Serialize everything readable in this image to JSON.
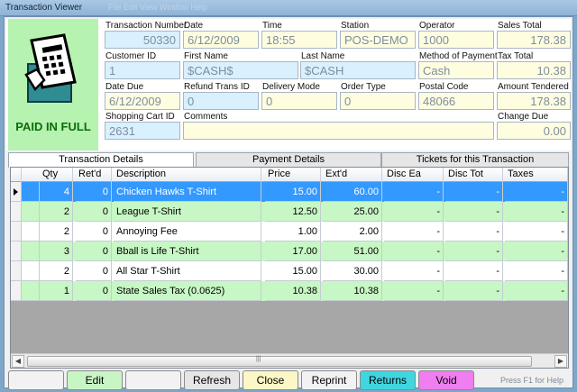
{
  "window": {
    "title": "Transaction Viewer",
    "ghost_menu": "File   Edit   View   Window   Help"
  },
  "status": {
    "paid_label": "PAID IN FULL"
  },
  "fields": {
    "transaction_number": {
      "label": "Transaction Number",
      "value": "50330"
    },
    "date": {
      "label": "Date",
      "value": "6/12/2009"
    },
    "time": {
      "label": "Time",
      "value": "18:55"
    },
    "station": {
      "label": "Station",
      "value": "POS-DEMO"
    },
    "operator": {
      "label": "Operator",
      "value": "1000"
    },
    "sales_total": {
      "label": "Sales Total",
      "value": "178.38"
    },
    "customer_id": {
      "label": "Customer ID",
      "value": "1"
    },
    "first_name": {
      "label": "First Name",
      "value": "$CASH$"
    },
    "last_name": {
      "label": "Last Name",
      "value": "$CASH"
    },
    "method_of_payment": {
      "label": "Method of Payment",
      "value": "Cash"
    },
    "tax_total": {
      "label": "Tax Total",
      "value": "10.38"
    },
    "date_due": {
      "label": "Date Due",
      "value": "6/12/2009"
    },
    "refund_trans_id": {
      "label": "Refund Trans ID",
      "value": "0"
    },
    "delivery_mode": {
      "label": "Delivery Mode",
      "value": "0"
    },
    "order_type": {
      "label": "Order Type",
      "value": "0"
    },
    "postal_code": {
      "label": "Postal Code",
      "value": "48066"
    },
    "amount_tendered": {
      "label": "Amount Tendered",
      "value": "178.38"
    },
    "shopping_cart_id": {
      "label": "Shopping Cart ID",
      "value": "2631"
    },
    "comments": {
      "label": "Comments",
      "value": ""
    },
    "change_due": {
      "label": "Change Due",
      "value": "0.00"
    }
  },
  "tabs": [
    {
      "label": "Transaction Details"
    },
    {
      "label": "Payment Details"
    },
    {
      "label": "Tickets for this Transaction"
    }
  ],
  "grid": {
    "columns": [
      "Qty",
      "Ret'd",
      "Description",
      "Price",
      "Ext'd",
      "Disc Ea",
      "Disc Tot",
      "Taxes"
    ],
    "rows": [
      {
        "qty": "4",
        "retd": "0",
        "description": "Chicken Hawks T-Shirt",
        "price": "15.00",
        "extd": "60.00",
        "disc_ea": "-",
        "disc_tot": "-",
        "taxes": "-"
      },
      {
        "qty": "2",
        "retd": "0",
        "description": "League T-Shirt",
        "price": "12.50",
        "extd": "25.00",
        "disc_ea": "-",
        "disc_tot": "-",
        "taxes": "-"
      },
      {
        "qty": "2",
        "retd": "0",
        "description": "Annoying Fee",
        "price": "1.00",
        "extd": "2.00",
        "disc_ea": "-",
        "disc_tot": "-",
        "taxes": "-"
      },
      {
        "qty": "3",
        "retd": "0",
        "description": "Bball is Life T-Shirt",
        "price": "17.00",
        "extd": "51.00",
        "disc_ea": "-",
        "disc_tot": "-",
        "taxes": "-"
      },
      {
        "qty": "2",
        "retd": "0",
        "description": "All Star T-Shirt",
        "price": "15.00",
        "extd": "30.00",
        "disc_ea": "-",
        "disc_tot": "-",
        "taxes": "-"
      },
      {
        "qty": "1",
        "retd": "0",
        "description": "State Sales Tax (0.0625)",
        "price": "10.38",
        "extd": "10.38",
        "disc_ea": "-",
        "disc_tot": "-",
        "taxes": "-"
      }
    ]
  },
  "buttons": {
    "blank1": "",
    "edit": "Edit",
    "blank2": "",
    "refresh": "Refresh",
    "close": "Close",
    "reprint": "Reprint",
    "returns": "Returns",
    "void": "Void"
  },
  "help_text": "Press F1 for Help",
  "colors": {
    "paid_panel": "#b6f2b0",
    "paid_text": "#0b6e0b",
    "selected_row": "#3399ff",
    "green_row": "#c7f7c4",
    "returns_button": "#3fd6e0",
    "void_button": "#f07ef0"
  }
}
